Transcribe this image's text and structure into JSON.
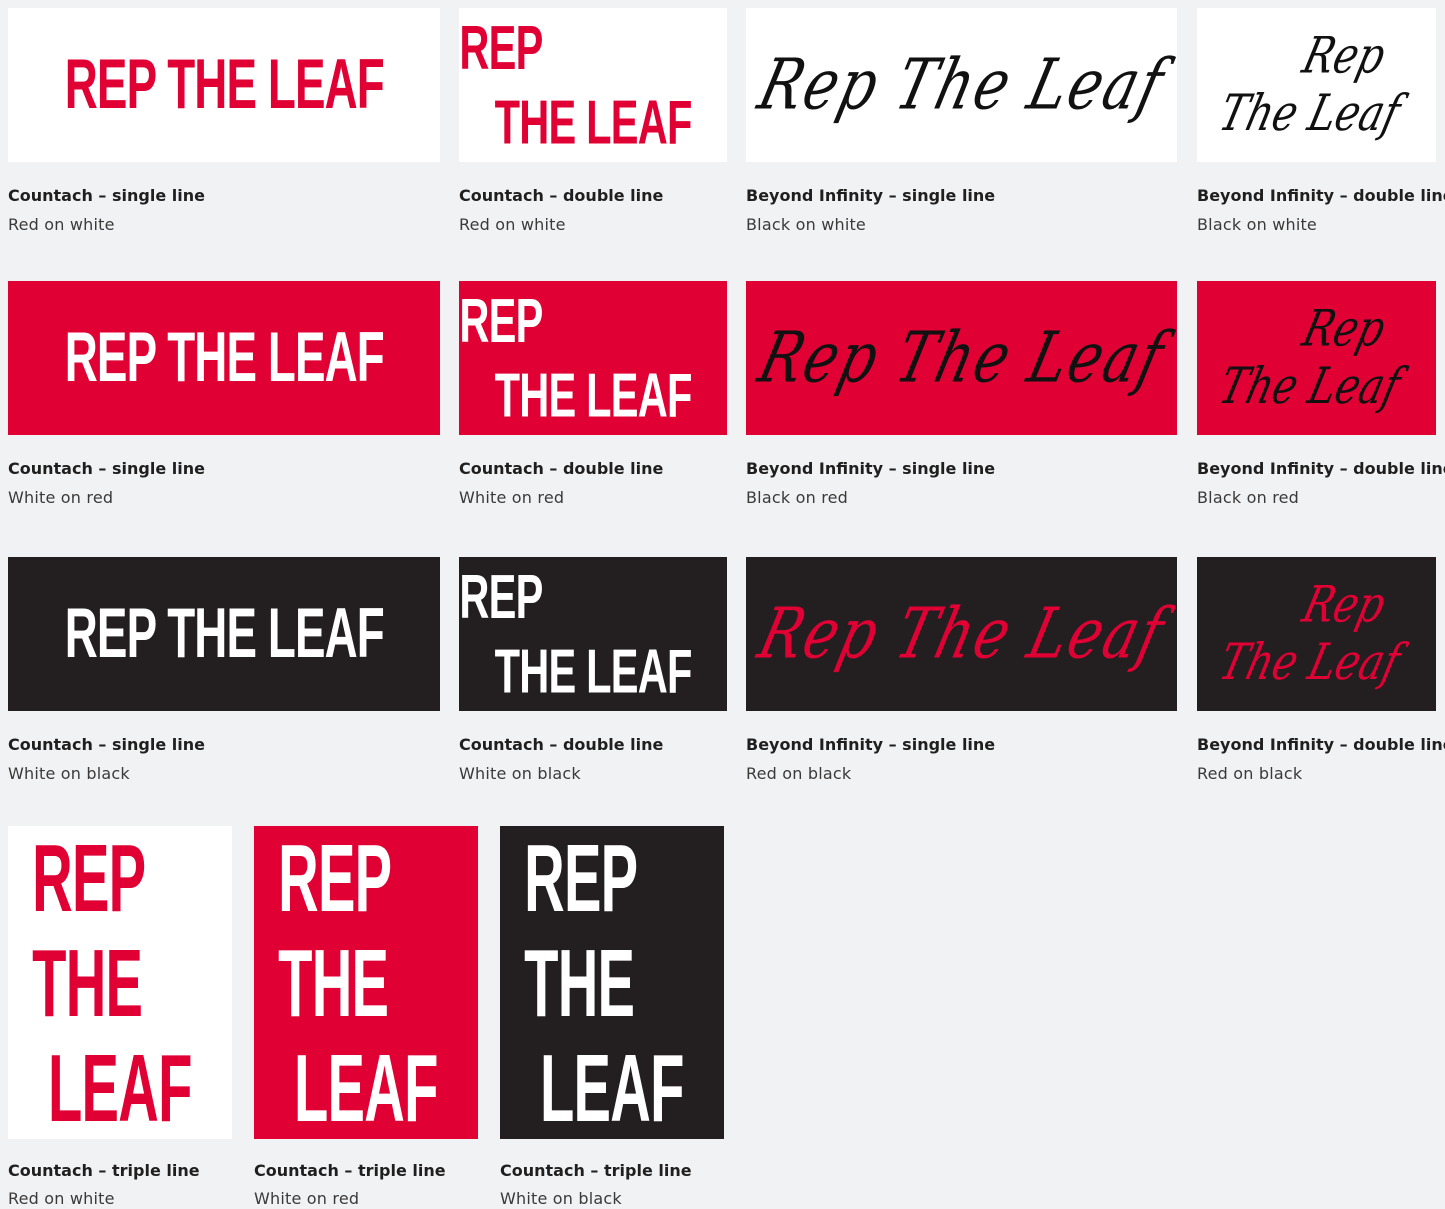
{
  "colors": {
    "page_bg": "#f1f2f4",
    "red": "#e00034",
    "black": "#231f20",
    "white": "#ffffff"
  },
  "wordmarks": {
    "countach_single": "REP THE LEAF",
    "countach_double": [
      "REP",
      "THE LEAF"
    ],
    "countach_triple": [
      "REP",
      "THE",
      "LEAF"
    ],
    "script_single": "Rep The Leaf",
    "script_double": [
      "Rep",
      "The Leaf"
    ]
  },
  "rows": [
    [
      {
        "title": "Countach – single line",
        "subtitle": "Red on white"
      },
      {
        "title": "Countach – double line",
        "subtitle": "Red on white"
      },
      {
        "title": "Beyond Infinity – single line",
        "subtitle": "Black on white"
      },
      {
        "title": "Beyond Infinity – double line",
        "subtitle": "Black on white"
      }
    ],
    [
      {
        "title": "Countach – single line",
        "subtitle": "White on red"
      },
      {
        "title": "Countach – double line",
        "subtitle": "White on red"
      },
      {
        "title": "Beyond Infinity – single line",
        "subtitle": "Black on red"
      },
      {
        "title": "Beyond Infinity – double line",
        "subtitle": "Black on red"
      }
    ],
    [
      {
        "title": "Countach – single line",
        "subtitle": "White on black"
      },
      {
        "title": "Countach – double line",
        "subtitle": "White on black"
      },
      {
        "title": "Beyond Infinity – single line",
        "subtitle": "Red on black"
      },
      {
        "title": "Beyond Infinity – double line",
        "subtitle": "Red on black"
      }
    ],
    [
      {
        "title": "Countach – triple line",
        "subtitle": "Red on white"
      },
      {
        "title": "Countach – triple line",
        "subtitle": "White on red"
      },
      {
        "title": "Countach – triple line",
        "subtitle": "White on black"
      }
    ]
  ]
}
